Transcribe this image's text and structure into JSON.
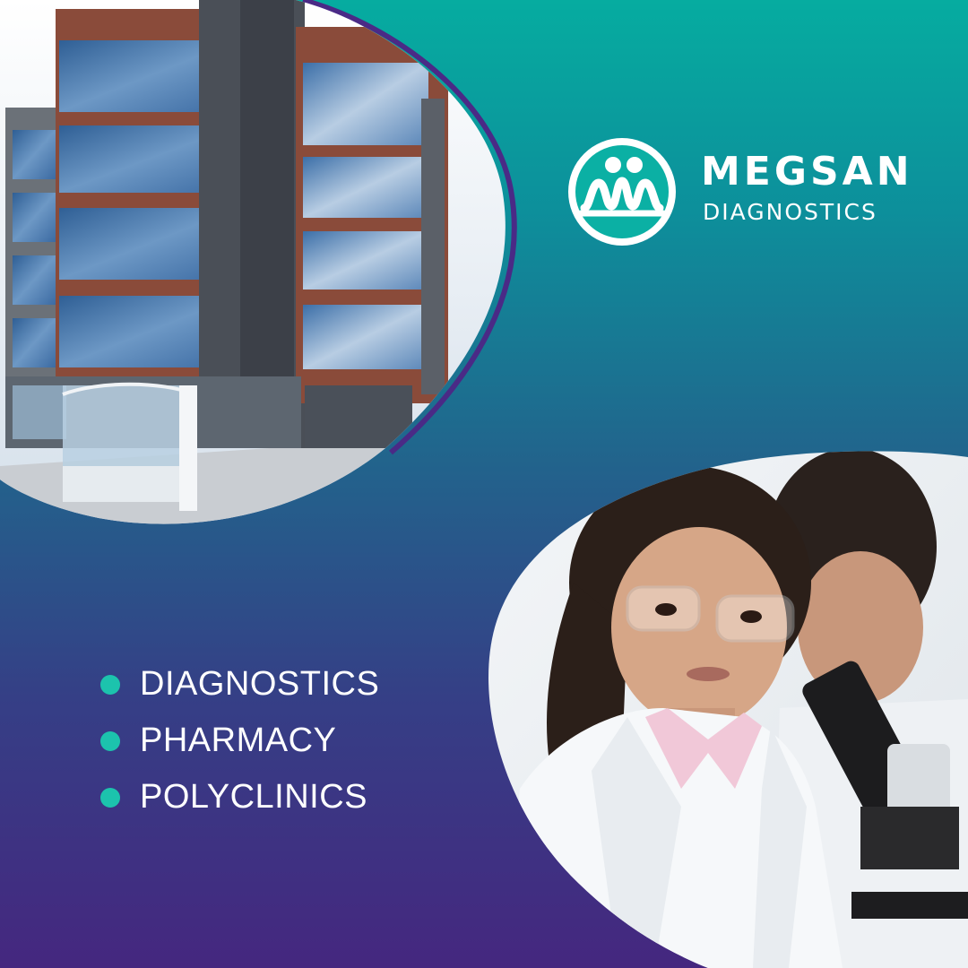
{
  "brand": {
    "name": "MEGSAN",
    "tagline": "DIAGNOSTICS",
    "logo_icon": "people-wave-logo-icon",
    "colors": {
      "gradient_top": "#06aca0",
      "gradient_bottom": "#45277f",
      "bullet": "#1cc3ad",
      "outline": "#4a2a86",
      "text": "#ffffff"
    }
  },
  "services": [
    {
      "label": "DIAGNOSTICS"
    },
    {
      "label": "PHARMACY"
    },
    {
      "label": "POLYCLINICS"
    }
  ]
}
